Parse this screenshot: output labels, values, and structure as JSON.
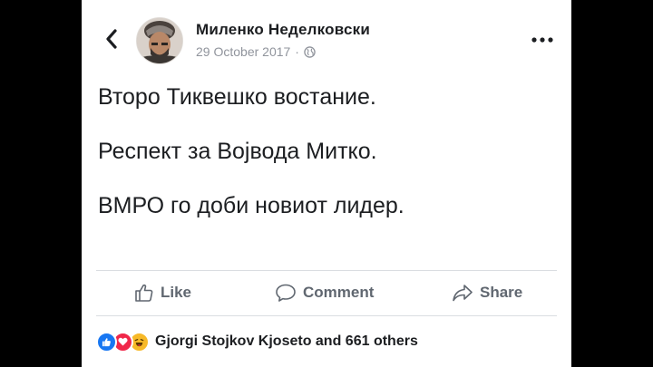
{
  "post": {
    "author_name": "Миленко Неделковски",
    "date": "29 October 2017",
    "separator": "·",
    "privacy_icon": "globe-icon",
    "text_lines": [
      "Второ Тиквешко востание.",
      "",
      "Респект за Војвода Митко.",
      "",
      "ВМРО го доби новиот лидер."
    ]
  },
  "actions": {
    "like_label": "Like",
    "comment_label": "Comment",
    "share_label": "Share"
  },
  "reactions": {
    "icons": [
      "like-reaction-icon",
      "love-reaction-icon",
      "haha-reaction-icon"
    ],
    "summary": "Gjorgi Stojkov Kjoseto and 661 others"
  },
  "colors": {
    "like_blue": "#1877f2",
    "love_red": "#f0284a",
    "haha_yellow": "#f7b928",
    "secondary_text": "#606770",
    "background": "#000000"
  }
}
